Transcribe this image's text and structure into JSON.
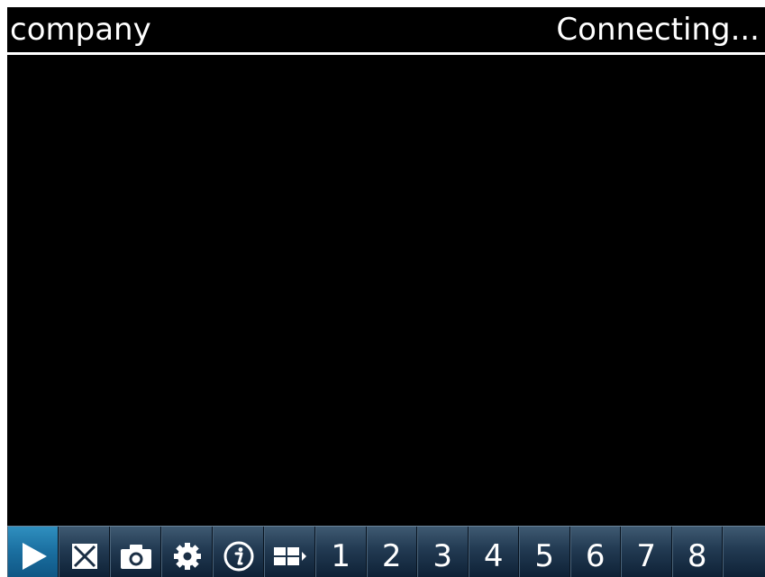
{
  "header": {
    "camera_name": "company",
    "status": "Connecting..."
  },
  "toolbar": {
    "icon_buttons": [
      {
        "icon": "play-icon",
        "selected": true
      },
      {
        "icon": "close-box-icon",
        "selected": false
      },
      {
        "icon": "camera-icon",
        "selected": false
      },
      {
        "icon": "gear-icon",
        "selected": false
      },
      {
        "icon": "info-icon",
        "selected": false
      },
      {
        "icon": "grid-layout-icon",
        "selected": false
      }
    ],
    "channels": [
      "1",
      "2",
      "3",
      "4",
      "5",
      "6",
      "7",
      "8"
    ]
  },
  "colors": {
    "background": "#000000",
    "text": "#ffffff",
    "toolbar_top": "#3f5a72",
    "toolbar_bottom": "#0e2136",
    "selected_button": "#1a6e9f"
  }
}
